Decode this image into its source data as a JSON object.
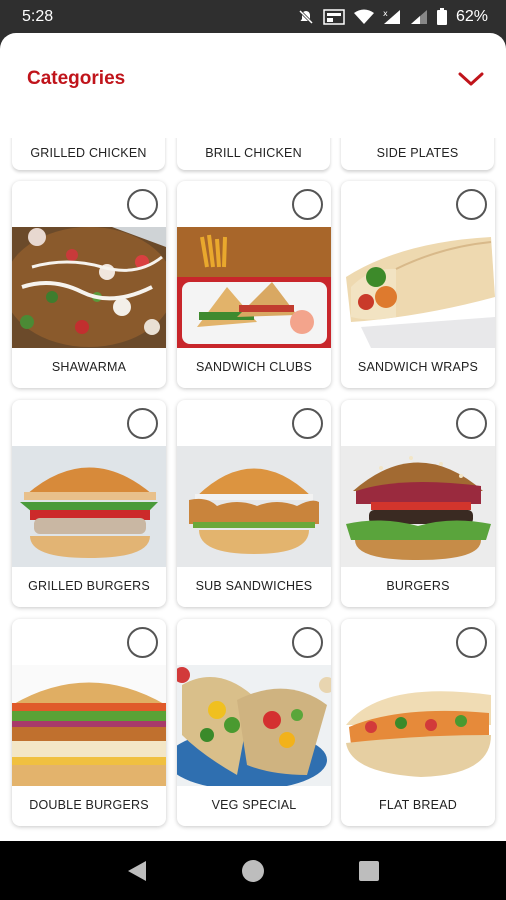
{
  "status_bar": {
    "time": "5:28",
    "battery": "62%",
    "icons": [
      "mute-icon",
      "news-icon",
      "wifi-icon",
      "signal-icon",
      "signal-weak-icon",
      "battery-icon"
    ]
  },
  "sheet": {
    "title": "Categories",
    "title_color": "#c0141b",
    "collapse_icon": "chevron-down-icon"
  },
  "top_row": [
    {
      "label": "GRILLED CHICKEN"
    },
    {
      "label": "BRILL CHICKEN"
    },
    {
      "label": "SIDE PLATES"
    }
  ],
  "categories": [
    {
      "label": "SHAWARMA",
      "selected": false
    },
    {
      "label": "SANDWICH CLUBS",
      "selected": false
    },
    {
      "label": "SANDWICH WRAPS",
      "selected": false
    },
    {
      "label": "GRILLED BURGERS",
      "selected": false
    },
    {
      "label": "SUB SANDWICHES",
      "selected": false
    },
    {
      "label": "BURGERS",
      "selected": false
    },
    {
      "label": "DOUBLE BURGERS",
      "selected": false
    },
    {
      "label": "VEG SPECIAL",
      "selected": false
    },
    {
      "label": "FLAT BREAD",
      "selected": false
    }
  ],
  "nav_bar": {
    "icons": [
      "back-icon",
      "home-icon",
      "recents-icon"
    ]
  }
}
